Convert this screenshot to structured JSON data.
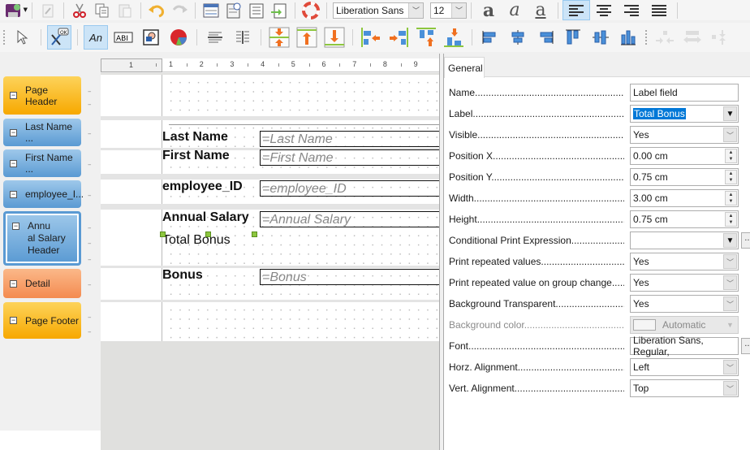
{
  "toolbar_top": {
    "font_name": "Liberation Sans",
    "font_size": "12",
    "buttons": [
      "save-icon",
      "edit-file-icon",
      "cut-icon",
      "copy-icon",
      "paste-icon",
      "undo-icon",
      "redo-icon",
      "report-navigator-icon",
      "page-properties-icon",
      "page-header-footer-icon",
      "report-header-footer-icon",
      "help-icon"
    ],
    "format": {
      "bold": "a",
      "italic": "a",
      "underline": "a"
    }
  },
  "toolbar_controls": {
    "buttons": [
      "select",
      "form-controls",
      "label",
      "text-box",
      "image",
      "chart",
      "horizontal-line",
      "vertical-line",
      "shrink",
      "shrink-top",
      "shrink-bottom",
      "align-left-objects",
      "align-right-objects",
      "align-top-objects",
      "align-bottom-objects",
      "align-left",
      "align-center",
      "align-right",
      "align-top",
      "align-middle",
      "align-bottom",
      "equal-width",
      "equal-spacing",
      "equal-height"
    ]
  },
  "ruler": {
    "margin_label": "1",
    "ticks": [
      "1",
      "2",
      "3",
      "4",
      "5",
      "6",
      "7",
      "8",
      "9"
    ]
  },
  "sections": [
    {
      "name": "Page Header",
      "color": "#f7a800"
    },
    {
      "name": "Last Name ...",
      "color": "#5a9ad3"
    },
    {
      "name": "First Name ...",
      "color": "#5a9ad3"
    },
    {
      "name": "employee_I...",
      "color": "#5a9ad3"
    },
    {
      "name": "Annu\nal Salary\nHeader",
      "lines": [
        "Annu",
        "al Salary",
        "Header"
      ],
      "color": "#5a9ad3",
      "selected": true
    },
    {
      "name": "Detail",
      "color": "#f48b50"
    },
    {
      "name": "Page Footer",
      "color": "#f7a800"
    }
  ],
  "report": {
    "labels": {
      "last_name": "Last Name",
      "first_name": "First Name",
      "employee_id": "employee_ID",
      "annual_salary": "Annual Salary",
      "total_bonus": "Total Bonus",
      "bonus": "Bonus"
    },
    "fields": {
      "last_name": "=Last Name",
      "first_name": "=First Name",
      "employee_id": "=employee_ID",
      "annual_salary": "=Annual Salary",
      "bonus": "=Bonus"
    }
  },
  "properties": {
    "tab": "General",
    "rows": [
      {
        "label": "Name....................................................................",
        "value": "Label field",
        "type": "text"
      },
      {
        "label": "Label....................................................................",
        "value": "Total Bonus",
        "type": "combo-selected"
      },
      {
        "label": "Visible...............................................................",
        "value": "Yes",
        "type": "select"
      },
      {
        "label": "Position X..........................................................",
        "value": "0.00 cm",
        "type": "spin"
      },
      {
        "label": "Position Y..........................................................",
        "value": "0.75 cm",
        "type": "spin"
      },
      {
        "label": "Width................................................................",
        "value": "3.00 cm",
        "type": "spin"
      },
      {
        "label": "Height...............................................................",
        "value": "0.75 cm",
        "type": "spin"
      },
      {
        "label": "Conditional Print Expression.....................",
        "value": "",
        "type": "combo-ellipsis"
      },
      {
        "label": "Print repeated values.......................................",
        "value": "Yes",
        "type": "select"
      },
      {
        "label": "Print repeated value on group change.....",
        "value": "Yes",
        "type": "select"
      },
      {
        "label": "Background Transparent...........................",
        "value": "Yes",
        "type": "select"
      },
      {
        "label": "Background color..........................................",
        "value": "Automatic",
        "type": "color-disabled"
      },
      {
        "label": "Font....................................................................",
        "value": "Liberation Sans, Regular,",
        "type": "text-ellipsis"
      },
      {
        "label": "Horz. Alignment...........................................",
        "value": "Left",
        "type": "select"
      },
      {
        "label": "Vert. Alignment............................................",
        "value": "Top",
        "type": "select"
      }
    ]
  },
  "colors": {
    "accent": "#0078d7",
    "handle": "#8dc63f",
    "section_orange": "#f7a800",
    "section_blue": "#5a9ad3",
    "section_peach": "#f48b50"
  }
}
